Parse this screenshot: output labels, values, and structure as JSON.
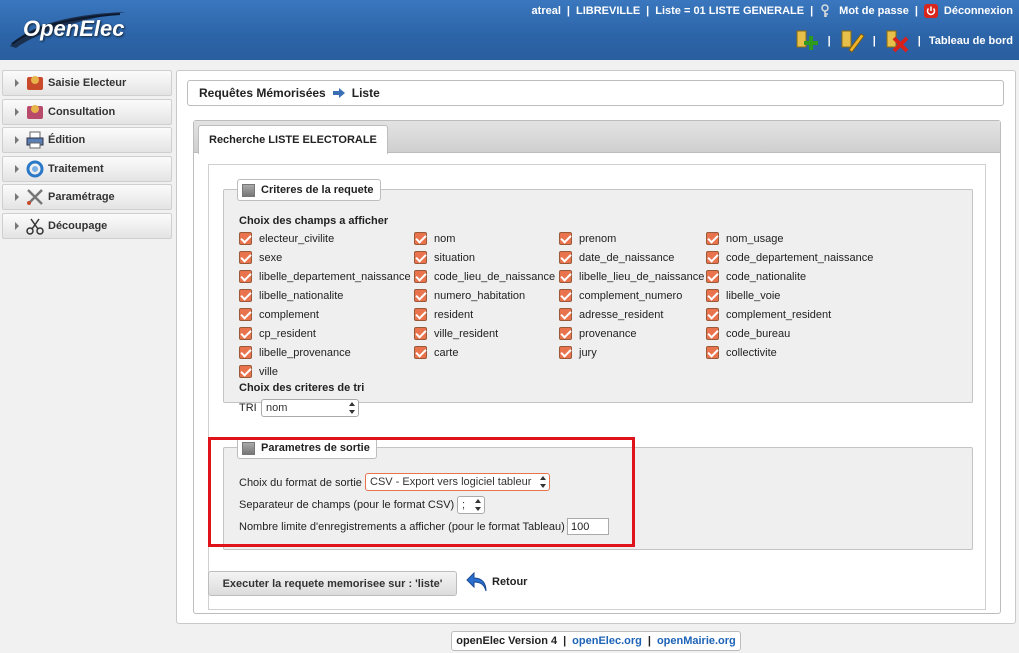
{
  "header": {
    "logo_text": "OpenElec",
    "user": "atreal",
    "collectivite": "LIBREVILLE",
    "liste": "Liste = 01 LISTE GENERALE",
    "password_link": "Mot de passe",
    "logout_link": "Déconnexion",
    "dashboard_link": "Tableau de bord",
    "separator": "|",
    "action_icons": [
      "add-icon",
      "edit-icon",
      "delete-icon"
    ]
  },
  "nav": {
    "items": [
      {
        "label": "Saisie Electeur",
        "icon": "voter-entry-icon"
      },
      {
        "label": "Consultation",
        "icon": "consultation-icon"
      },
      {
        "label": "Édition",
        "icon": "printer-icon"
      },
      {
        "label": "Traitement",
        "icon": "processing-icon"
      },
      {
        "label": "Paramétrage",
        "icon": "tools-icon"
      },
      {
        "label": "Découpage",
        "icon": "scissors-icon"
      }
    ]
  },
  "breadcrumb": {
    "part1": "Requêtes Mémorisées",
    "part2": "Liste"
  },
  "tab": {
    "label": "Recherche LISTE ELECTORALE"
  },
  "criteres": {
    "legend": "Criteres de la requete",
    "fields_heading": "Choix des champs a afficher",
    "fields": [
      "electeur_civilite",
      "nom",
      "prenom",
      "nom_usage",
      "sexe",
      "situation",
      "date_de_naissance",
      "code_departement_naissance",
      "libelle_departement_naissance",
      "code_lieu_de_naissance",
      "libelle_lieu_de_naissance",
      "code_nationalite",
      "libelle_nationalite",
      "numero_habitation",
      "complement_numero",
      "libelle_voie",
      "complement",
      "resident",
      "adresse_resident",
      "complement_resident",
      "cp_resident",
      "ville_resident",
      "provenance",
      "code_bureau",
      "libelle_provenance",
      "carte",
      "jury",
      "collectivite",
      "ville"
    ],
    "sort_heading": "Choix des criteres de tri",
    "tri_label": "TRI",
    "tri_value": "nom"
  },
  "sortie": {
    "legend": "Parametres de sortie",
    "format_label": "Choix du format de sortie",
    "format_value": "CSV - Export vers logiciel tableur",
    "separator_label": "Separateur de champs (pour le format CSV)",
    "separator_value": ";",
    "limit_label": "Nombre limite d'enregistrements a afficher (pour le format Tableau)",
    "limit_value": "100",
    "highlight_color": "#e0121a"
  },
  "buttons": {
    "execute": "Executer la requete memorisee sur : 'liste'",
    "back": "Retour"
  },
  "footer": {
    "version": "openElec Version 4",
    "link1": "openElec.org",
    "link2": "openMairie.org",
    "separator": "|"
  },
  "colors": {
    "header_blue": "#2c64a8",
    "checkbox": "#e9734d",
    "link": "#1c63b7"
  }
}
